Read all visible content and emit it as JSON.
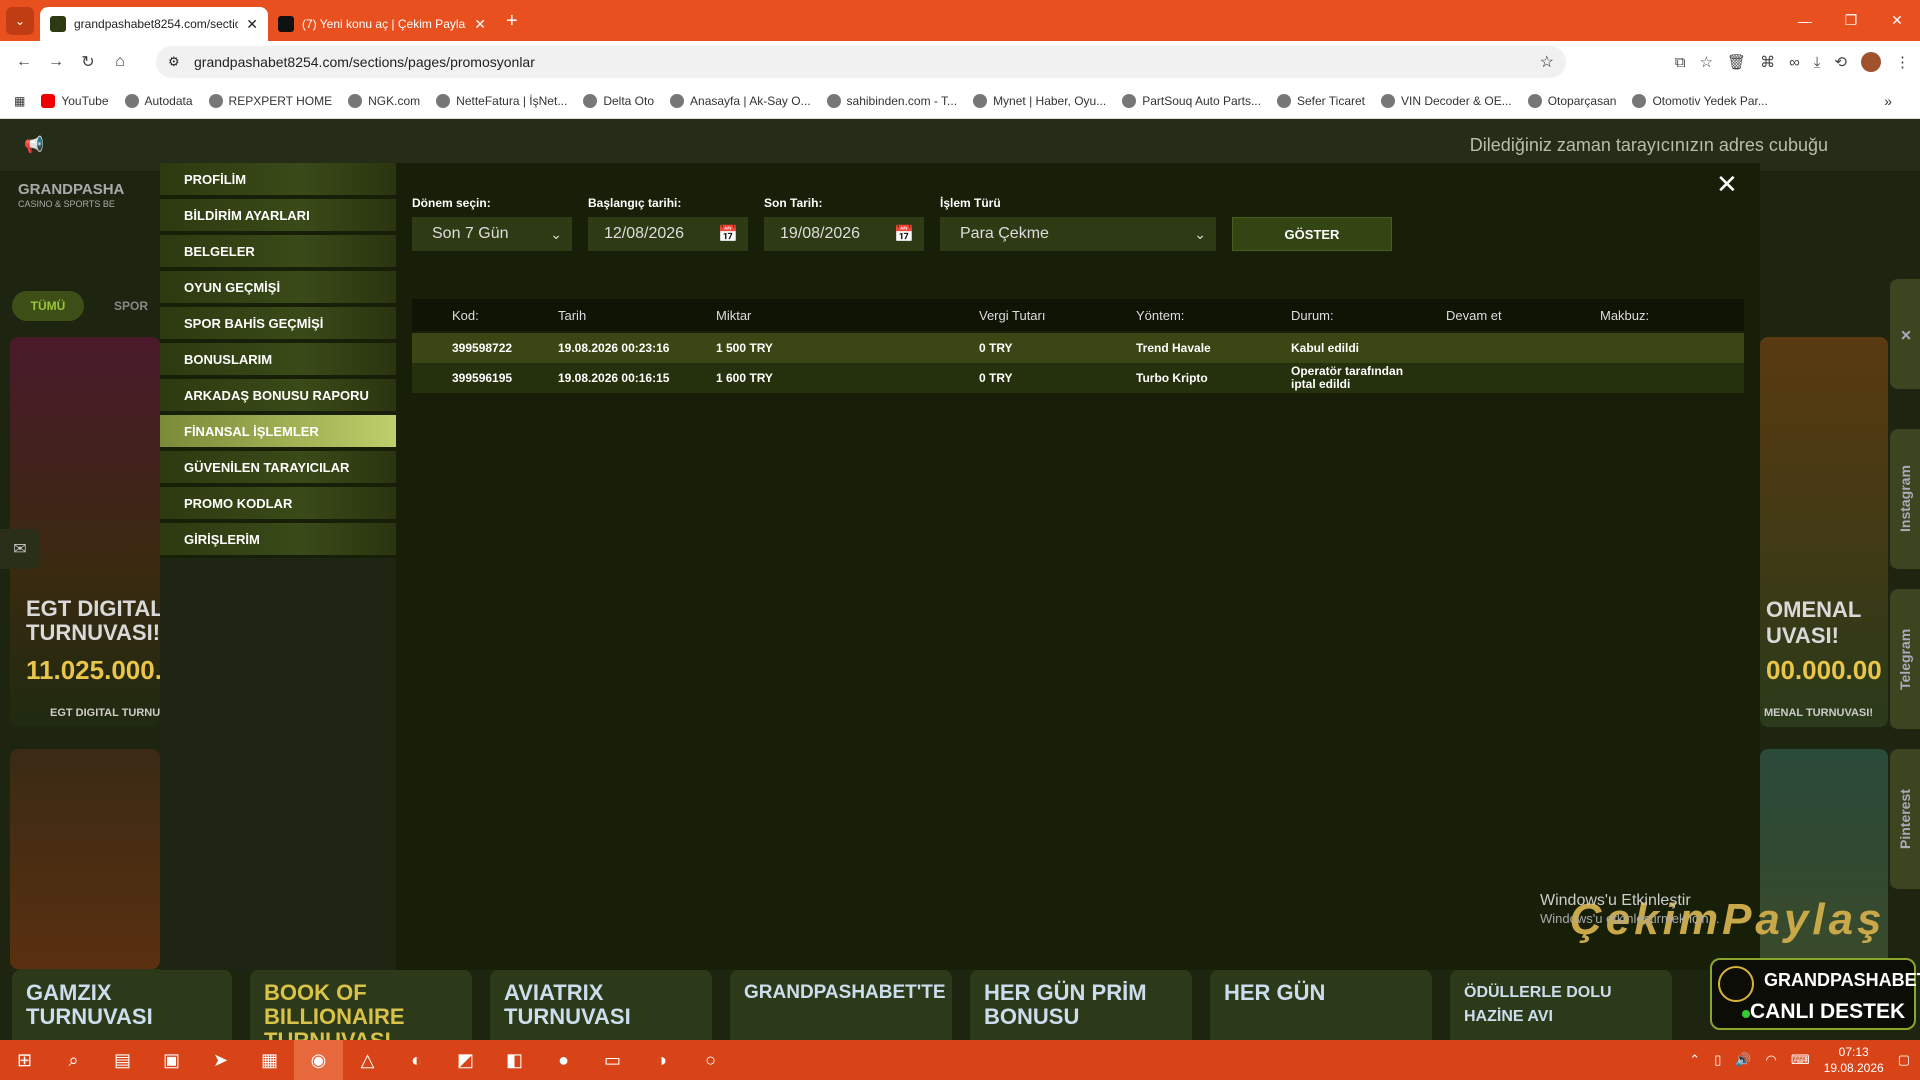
{
  "browser": {
    "tabs": [
      {
        "title": "grandpashabet8254.com/sectio",
        "active": true
      },
      {
        "title": "(7) Yeni konu aç | Çekim Paylaş",
        "active": false
      }
    ],
    "url": "grandpashabet8254.com/sections/pages/promosyonlar",
    "bookmarks": [
      "YouTube",
      "Autodata",
      "REPXPERT HOME",
      "NGK.com",
      "NetteFatura | İşNet...",
      "Delta Oto",
      "Anasayfa | Ak-Say O...",
      "sahibinden.com - T...",
      "Mynet | Haber, Oyu...",
      "PartSouq Auto Parts...",
      "Sefer Ticaret",
      "VIN Decoder & OE...",
      "Otoparçasan",
      "Otomotiv Yedek Par..."
    ]
  },
  "site": {
    "marquee": "Dilediğiniz zaman tarayıcınızın adres cubuğu",
    "logo": "GRANDPASHA",
    "logo_sub": "CASINO & SPORTS BE",
    "filters": [
      "TÜMÜ",
      "SPOR"
    ],
    "left_banner_text": "EGT DIGITAL TURNUVASI!",
    "left_banner_amount": "11.025.000.",
    "left_banner_caption": "EGT DIGITAL TURNU",
    "right_banner_text": "OMENAL UVASI!",
    "right_banner_amount": "00.000.00",
    "right_banner_caption": "MENAL TURNUVASI!",
    "side_tabs": [
      "Instagram",
      "Telegram",
      "Pinterest"
    ],
    "bottom_cards": [
      "GAMZIX TURNUVASI",
      "BOOK OF BILLIONAIRE TURNUVASI",
      "AVIATRIX TURNUVASI",
      "GRANDPASHABET'TE",
      "HER GÜN PRİM BONUSU",
      "HER GÜN",
      "ÖDÜLLERLE DOLU HAZİNE AVI"
    ]
  },
  "modal": {
    "menu": [
      {
        "label": "PROFİLİM",
        "active": false
      },
      {
        "label": "BİLDİRİM AYARLARI",
        "active": false
      },
      {
        "label": "BELGELER",
        "active": false
      },
      {
        "label": "OYUN GEÇMİŞİ",
        "active": false
      },
      {
        "label": "SPOR BAHİS GEÇMİŞİ",
        "active": false
      },
      {
        "label": "BONUSLARIM",
        "active": false
      },
      {
        "label": "ARKADAŞ BONUSU RAPORU",
        "active": false
      },
      {
        "label": "FİNANSAL İŞLEMLER",
        "active": true
      },
      {
        "label": "GÜVENİLEN TARAYICILAR",
        "active": false
      },
      {
        "label": "PROMO KODLAR",
        "active": false
      },
      {
        "label": "GİRİŞLERİM",
        "active": false
      }
    ],
    "filters": {
      "period_label": "Dönem seçin:",
      "period_value": "Son 7 Gün",
      "start_label": "Başlangıç tarihi:",
      "start_value": "12/08/2026",
      "end_label": "Son Tarih:",
      "end_value": "19/08/2026",
      "type_label": "İşlem Türü",
      "type_value": "Para Çekme",
      "show_button": "GÖSTER"
    },
    "table": {
      "headers": [
        "Kod:",
        "Tarih",
        "Miktar",
        "Vergi Tutarı",
        "Yöntem:",
        "Durum:",
        "Devam et",
        "Makbuz:"
      ],
      "rows": [
        {
          "kod": "399598722",
          "tarih": "19.08.2026 00:23:16",
          "miktar": "1 500 TRY",
          "vergi": "0 TRY",
          "yontem": "Trend Havale",
          "durum": "Kabul edildi",
          "durum2": ""
        },
        {
          "kod": "399596195",
          "tarih": "19.08.2026 00:16:15",
          "miktar": "1 600 TRY",
          "vergi": "0 TRY",
          "yontem": "Turbo Kripto",
          "durum": "Operatör tarafından",
          "durum2": "iptal edildi"
        }
      ]
    }
  },
  "overlay": {
    "watermark_1": "Windows'u Etkinleştir",
    "watermark_2": "Windows'u etkinleştirmek için...",
    "cekim": "ÇekimPaylaş",
    "support_brand": "GRANDPASHABET",
    "support_label": "CANLI DESTEK"
  },
  "taskbar": {
    "time": "07:13",
    "date": "19.08.2026"
  }
}
